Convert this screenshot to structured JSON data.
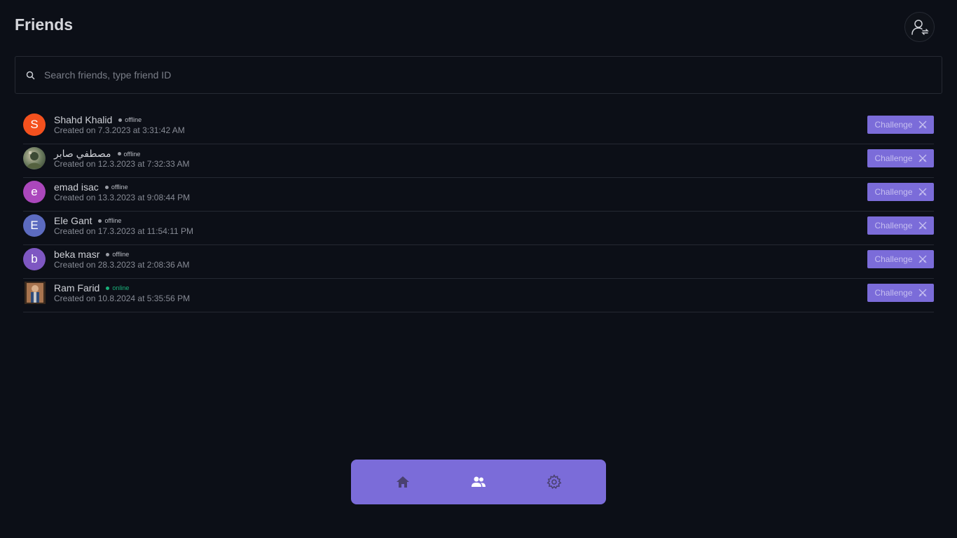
{
  "header": {
    "title": "Friends"
  },
  "search": {
    "placeholder": "Search friends, type friend ID"
  },
  "friends": [
    {
      "initial": "S",
      "avatar_type": "letter",
      "avatar_color": "#f4511e",
      "name": "Shahd Khalid",
      "status": "offline",
      "created": "Created on 7.3.2023 at 3:31:42 AM",
      "action": "Challenge"
    },
    {
      "initial": "",
      "avatar_type": "photo",
      "avatar_color": "#6b7b5e",
      "name": "مصطفي صابر",
      "status": "offline",
      "created": "Created on 12.3.2023 at 7:32:33 AM",
      "action": "Challenge"
    },
    {
      "initial": "e",
      "avatar_type": "letter",
      "avatar_color": "#ab47bc",
      "name": "emad isac",
      "status": "offline",
      "created": "Created on 13.3.2023 at 9:08:44 PM",
      "action": "Challenge"
    },
    {
      "initial": "E",
      "avatar_type": "letter",
      "avatar_color": "#5c6bc0",
      "name": "Ele Gant",
      "status": "offline",
      "created": "Created on 17.3.2023 at 11:54:11 PM",
      "action": "Challenge"
    },
    {
      "initial": "b",
      "avatar_type": "letter",
      "avatar_color": "#7e57c2",
      "name": "beka masr",
      "status": "offline",
      "created": "Created on 28.3.2023 at 2:08:36 AM",
      "action": "Challenge"
    },
    {
      "initial": "",
      "avatar_type": "photo",
      "avatar_color": "#8a5a3c",
      "name": "Ram Farid",
      "status": "online",
      "created": "Created on 10.8.2024 at 5:35:56 PM",
      "action": "Challenge"
    }
  ],
  "nav": [
    {
      "icon": "home-icon",
      "active": false
    },
    {
      "icon": "friends-icon",
      "active": true
    },
    {
      "icon": "gear-icon",
      "active": false
    }
  ],
  "colors": {
    "accent": "#7b6cd9",
    "background": "#0c0f17",
    "online": "#19b07a"
  }
}
